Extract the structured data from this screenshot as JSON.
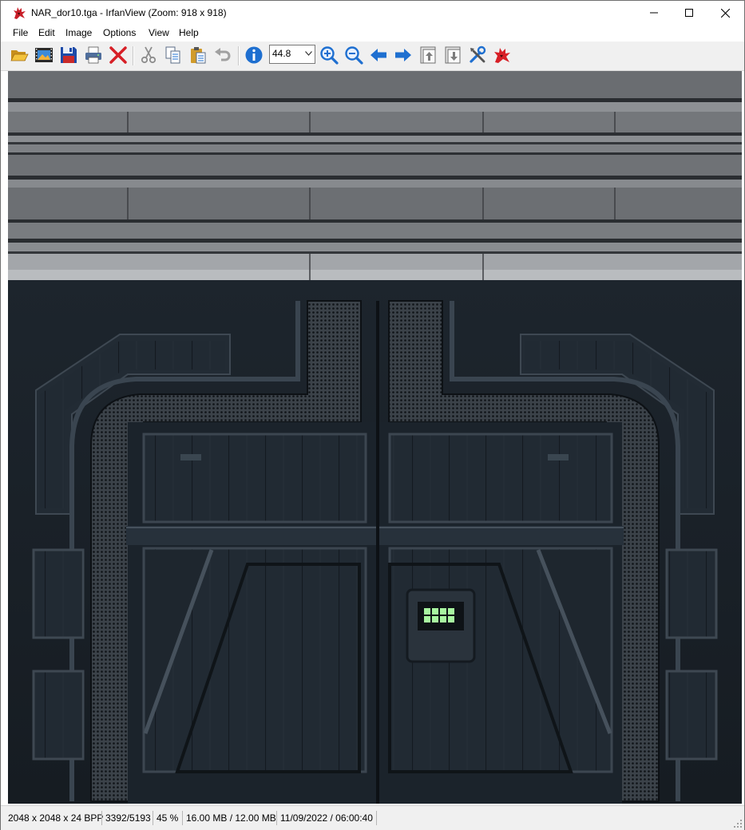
{
  "window": {
    "title": "NAR_dor10.tga - IrfanView (Zoom: 918 x 918)",
    "app_icon": "irfanview-red-cat-icon",
    "controls": [
      "minimize-icon",
      "maximize-icon",
      "close-icon"
    ]
  },
  "menu": [
    "File",
    "Edit",
    "Image",
    "Options",
    "View",
    "Help"
  ],
  "toolbar": {
    "buttons": [
      {
        "name": "open-folder-icon"
      },
      {
        "name": "slideshow-icon"
      },
      {
        "name": "save-icon"
      },
      {
        "name": "print-icon"
      },
      {
        "name": "delete-icon"
      },
      {
        "name": "cut-icon"
      },
      {
        "name": "copy-icon"
      },
      {
        "name": "paste-icon"
      },
      {
        "name": "undo-icon"
      },
      {
        "name": "info-icon"
      },
      {
        "name": "zoom-in-icon"
      },
      {
        "name": "zoom-out-icon"
      },
      {
        "name": "previous-image-icon"
      },
      {
        "name": "next-image-icon"
      },
      {
        "name": "first-image-icon"
      },
      {
        "name": "last-image-icon"
      },
      {
        "name": "settings-icon"
      },
      {
        "name": "irfanview-about-icon"
      }
    ],
    "zoom_value": "44.8"
  },
  "colors": {
    "accent_red": "#d71f26",
    "accent_blue": "#1e6fd0",
    "metal_panel": "#1b232b",
    "led_green": "#a8f5a0"
  },
  "status": {
    "dimensions": "2048 x 2048 x 24 BPP",
    "index": "3392/5193",
    "zoom": "45 %",
    "memory": "16.00 MB / 12.00 MB",
    "datetime": "11/09/2022 / 06:00:40"
  }
}
